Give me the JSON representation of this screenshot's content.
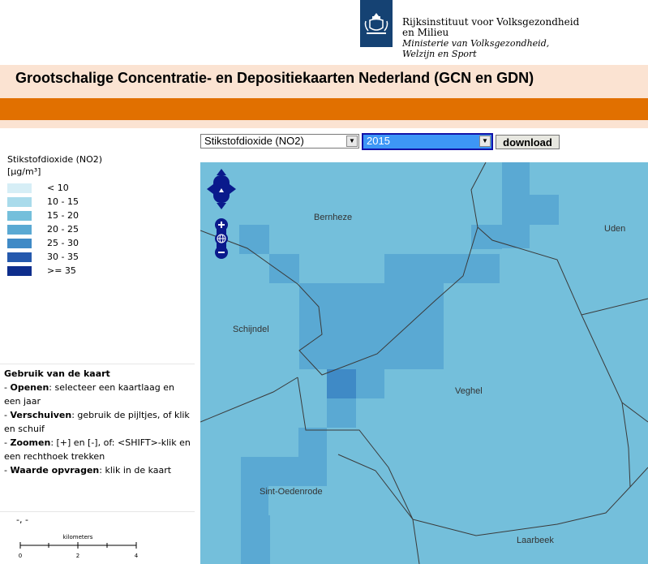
{
  "header": {
    "org_name_line1": "Rijksinstituut voor Volksgezondheid",
    "org_name_line2": "en Milieu",
    "ministry_line1": "Ministerie van Volksgezondheid,",
    "ministry_line2": "Welzijn en Sport",
    "page_title": "Grootschalige Concentratie- en Depositiekaarten Nederland (GCN en GDN)"
  },
  "controls": {
    "substance_selected": "Stikstofdioxide (NO2)",
    "year_selected": "2015",
    "download_label": "download"
  },
  "legend": {
    "title": "Stikstofdioxide (NO2)",
    "unit": "[µg/m³]",
    "classes": [
      {
        "label": "< 10",
        "color": "#d6eef6"
      },
      {
        "label": "10 - 15",
        "color": "#a9dbeb"
      },
      {
        "label": "15 - 20",
        "color": "#74bfdb"
      },
      {
        "label": "20 - 25",
        "color": "#5aa9d3"
      },
      {
        "label": "25 - 30",
        "color": "#3f8ac6"
      },
      {
        "label": "30 - 35",
        "color": "#2559ad"
      },
      {
        "label": ">= 35",
        "color": "#0e2e8c"
      }
    ]
  },
  "usage": {
    "heading": "Gebruik van de kaart",
    "items": [
      {
        "key": "Openen",
        "text": ": selecteer een kaartlaag en een jaar"
      },
      {
        "key": "Verschuiven",
        "text": ": gebruik de pijltjes, of klik en schuif"
      },
      {
        "key": "Zoomen",
        "text": ": [+] en [-], of: <SHIFT>-klik en een rechthoek trekken"
      },
      {
        "key": "Waarde opvragen",
        "text": ": klik in de kaart"
      }
    ]
  },
  "status": {
    "coordinates": "-, -",
    "scale_unit": "kilometers",
    "scale_ticks": [
      "0",
      "2",
      "4"
    ]
  },
  "map": {
    "places": [
      "Bernheze",
      "Uden",
      "Schijndel",
      "Veghel",
      "Sint-Oedenrode",
      "Laarbeek"
    ],
    "colors": {
      "base": "#74bfdb",
      "mid": "#5aa9d3",
      "high": "#3f8ac6",
      "border": "#3a3a3a"
    }
  }
}
